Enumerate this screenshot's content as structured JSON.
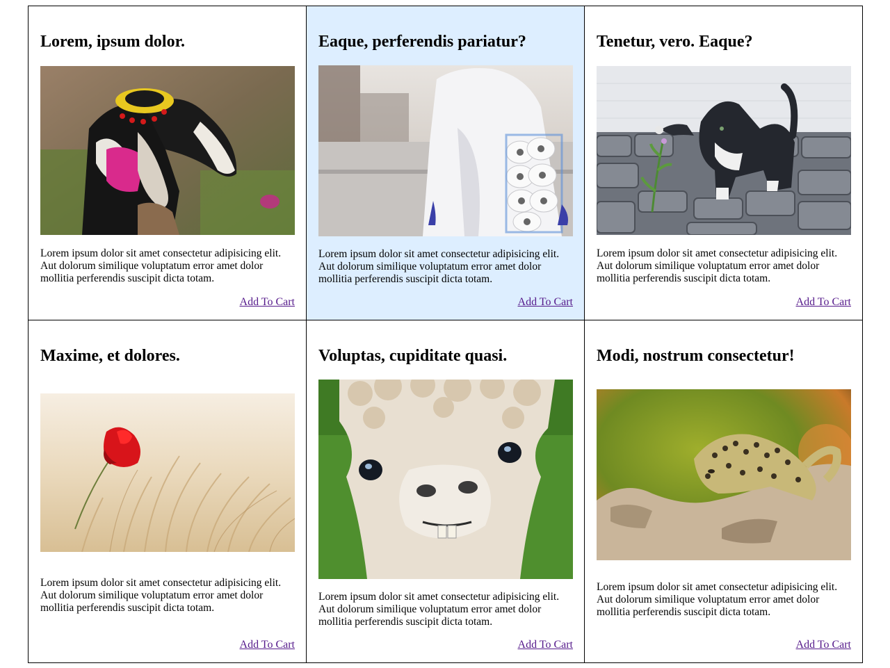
{
  "cards": [
    {
      "title": "Lorem, ipsum dolor.",
      "image_subject": "goat wearing a sombrero and pink bandana",
      "description": "Lorem ipsum dolor sit amet consectetur adipisicing elit. Aut dolorum similique voluptatum error amet dolor mollitia perferendis suscipit dicta totam.",
      "action": "Add To Cart"
    },
    {
      "title": "Eaque, perferendis pariatur?",
      "image_subject": "person in white protective suit holding toilet paper rolls",
      "description": "Lorem ipsum dolor sit amet consectetur adipisicing elit. Aut dolorum similique voluptatum error amet dolor mollitia perferendis suscipit dicta totam.",
      "action": "Add To Cart"
    },
    {
      "title": "Tenetur, vero. Eaque?",
      "image_subject": "kitten pawing at a plant on cobblestones",
      "description": "Lorem ipsum dolor sit amet consectetur adipisicing elit. Aut dolorum similique voluptatum error amet dolor mollitia perferendis suscipit dicta totam.",
      "action": "Add To Cart"
    },
    {
      "title": "Maxime, et dolores.",
      "image_subject": "red poppy in a wheat field",
      "description": "Lorem ipsum dolor sit amet consectetur adipisicing elit. Aut dolorum similique voluptatum error amet dolor mollitia perferendis suscipit dicta totam.",
      "action": "Add To Cart"
    },
    {
      "title": "Voluptas, cupiditate quasi.",
      "image_subject": "close-up of an alpaca face",
      "description": "Lorem ipsum dolor sit amet consectetur adipisicing elit. Aut dolorum similique voluptatum error amet dolor mollitia perferendis suscipit dicta totam.",
      "action": "Add To Cart"
    },
    {
      "title": "Modi, nostrum consectetur!",
      "image_subject": "leopard gecko on a rock",
      "description": "Lorem ipsum dolor sit amet consectetur adipisicing elit. Aut dolorum similique voluptatum error amet dolor mollitia perferendis suscipit dicta totam.",
      "action": "Add To Cart"
    }
  ],
  "colors": {
    "highlight_background": "#ddeeff",
    "link": "#551a8b",
    "border": "#000000"
  }
}
